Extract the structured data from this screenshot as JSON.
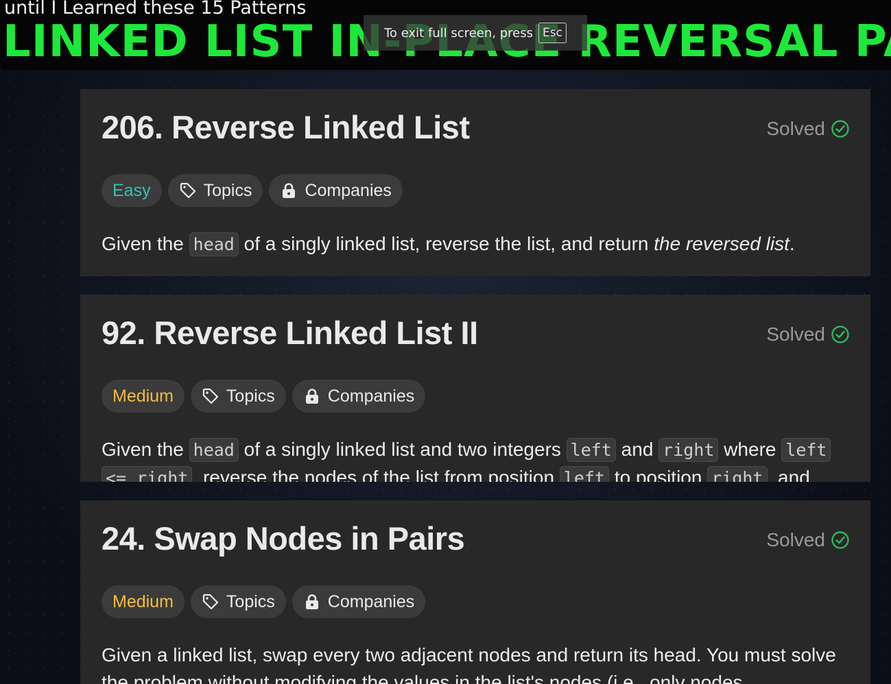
{
  "video_overlay": {
    "subtitle": "until I Learned these 15 Patterns",
    "headline": "LINKED LIST IN-PLACE REVERSAL PATTERN"
  },
  "fullscreen_notice": {
    "text": "To exit full screen, press",
    "key": "Esc"
  },
  "problems": [
    {
      "title": "206. Reverse Linked List",
      "status": "Solved",
      "difficulty": "Easy",
      "topics_label": "Topics",
      "companies_label": "Companies",
      "description": {
        "t1": "Given the",
        "c1": "head",
        "t2": "of a singly linked list, reverse the list, and return",
        "e1": "the reversed list",
        "t3": "."
      }
    },
    {
      "title": "92. Reverse Linked List II",
      "status": "Solved",
      "difficulty": "Medium",
      "topics_label": "Topics",
      "companies_label": "Companies",
      "description": {
        "t1": "Given the",
        "c1": "head",
        "t2": "of a singly linked list and two integers",
        "c2": "left",
        "t3": "and",
        "c3": "right",
        "t4": "where",
        "c4": "left",
        "c5": "<= right",
        "t5": ", reverse the nodes of the list from position",
        "c6": "left",
        "t6": "to position",
        "c7": "right",
        "t7": ", and"
      }
    },
    {
      "title": "24. Swap Nodes in Pairs",
      "status": "Solved",
      "difficulty": "Medium",
      "topics_label": "Topics",
      "companies_label": "Companies",
      "description": {
        "text": "Given a linked list, swap every two adjacent nodes and return its head. You must solve the problem without modifying the values in the list's nodes (i.e., only nodes"
      }
    }
  ],
  "colors": {
    "headline": "#1ee83a",
    "easy": "#35c2b1",
    "medium": "#f2bd3b",
    "solved_icon": "#2fb55a"
  }
}
